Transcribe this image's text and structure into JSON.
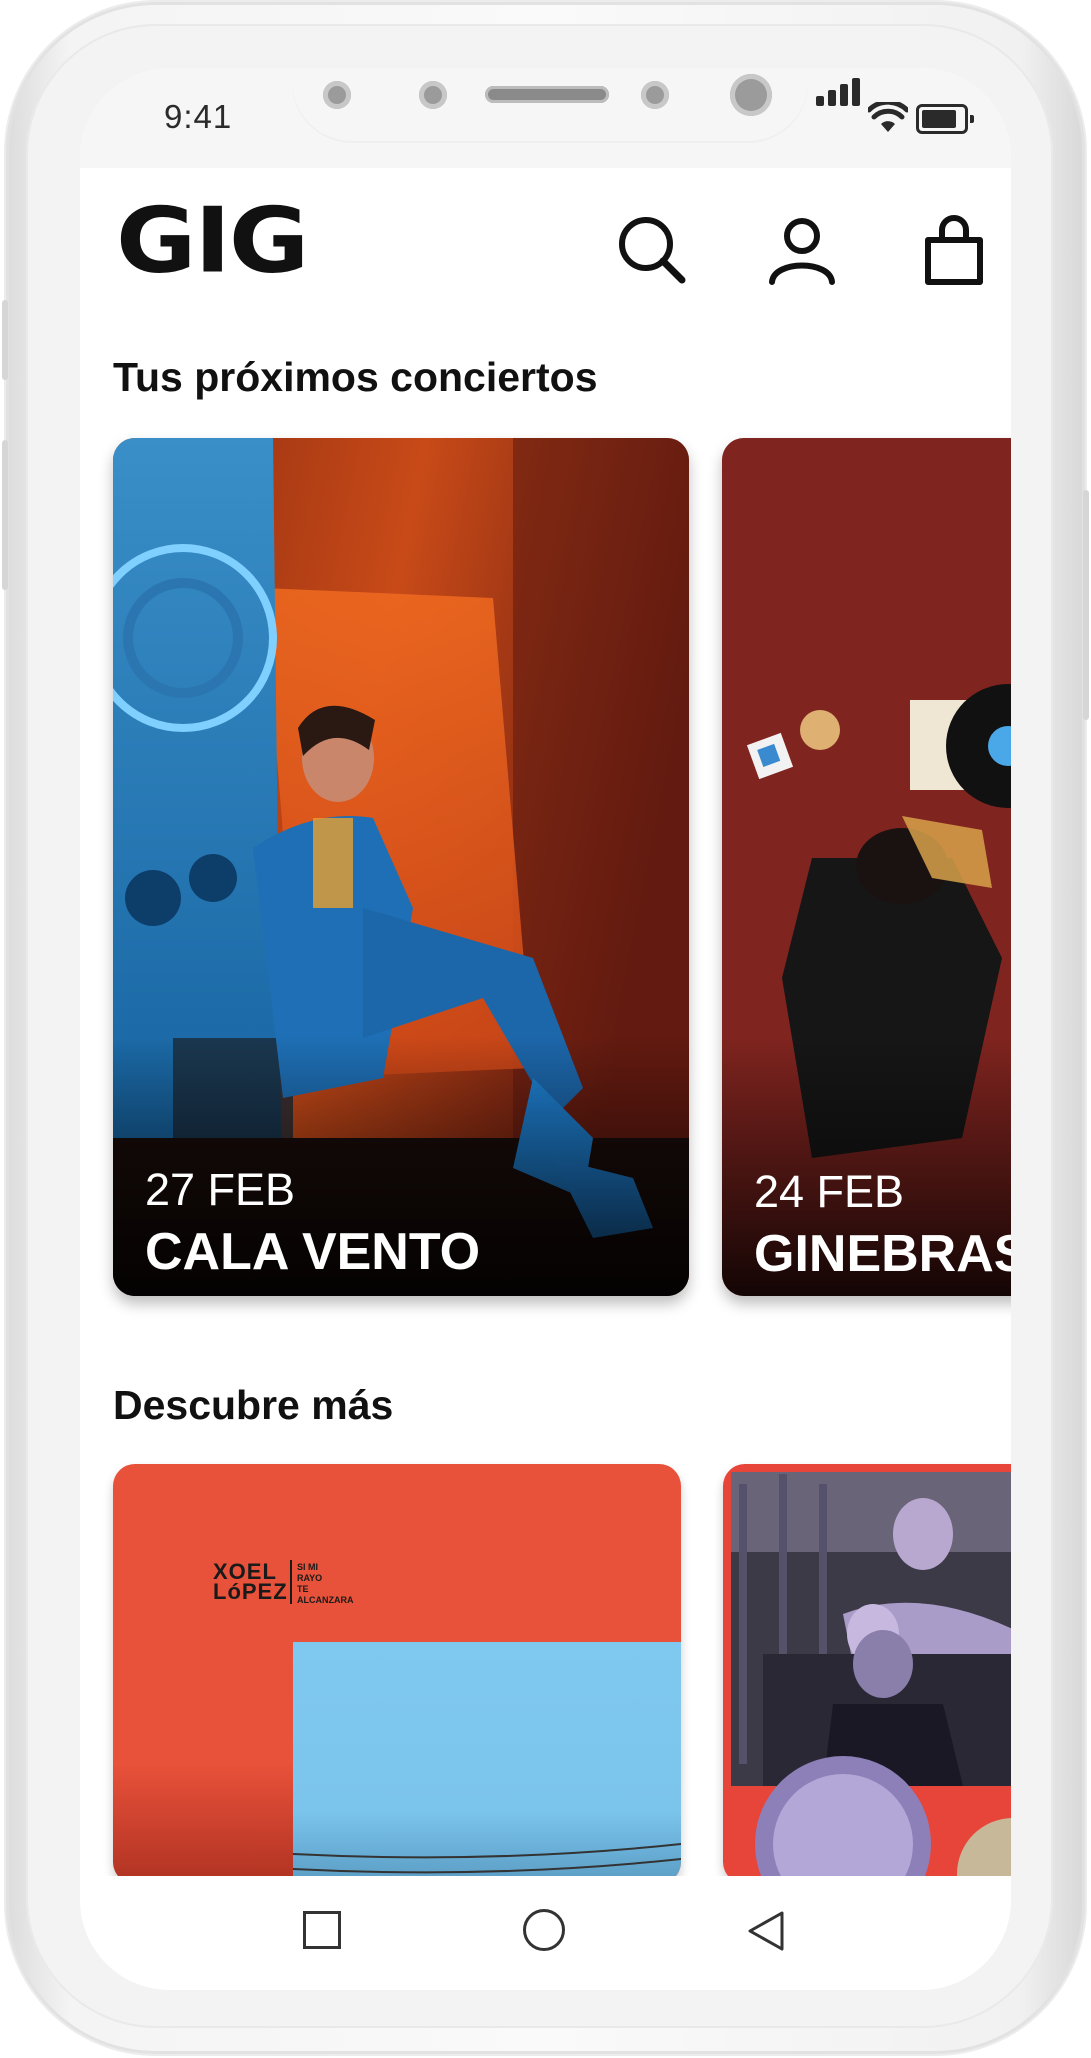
{
  "status_bar": {
    "time": "9:41"
  },
  "header": {
    "logo": "GIG"
  },
  "upcoming": {
    "title": "Tus próximos conciertos",
    "cards": [
      {
        "date": "27 FEB",
        "artist": "CALA VENTO"
      },
      {
        "date": "24 FEB",
        "artist": "GINEBRAS"
      }
    ]
  },
  "discover": {
    "title": "Descubre más",
    "cards": [
      {
        "cover_artist_line1": "XOEL",
        "cover_artist_line2": "LóPEZ",
        "cover_subtitle_1": "SI MI",
        "cover_subtitle_2": "RAYO",
        "cover_subtitle_3": "TE",
        "cover_subtitle_4": "ALCANZARA"
      },
      {
        "cover_artist": ""
      }
    ]
  },
  "colors": {
    "accent_red": "#e8513a",
    "sky_blue": "#7fc8f0",
    "text": "#111111"
  }
}
